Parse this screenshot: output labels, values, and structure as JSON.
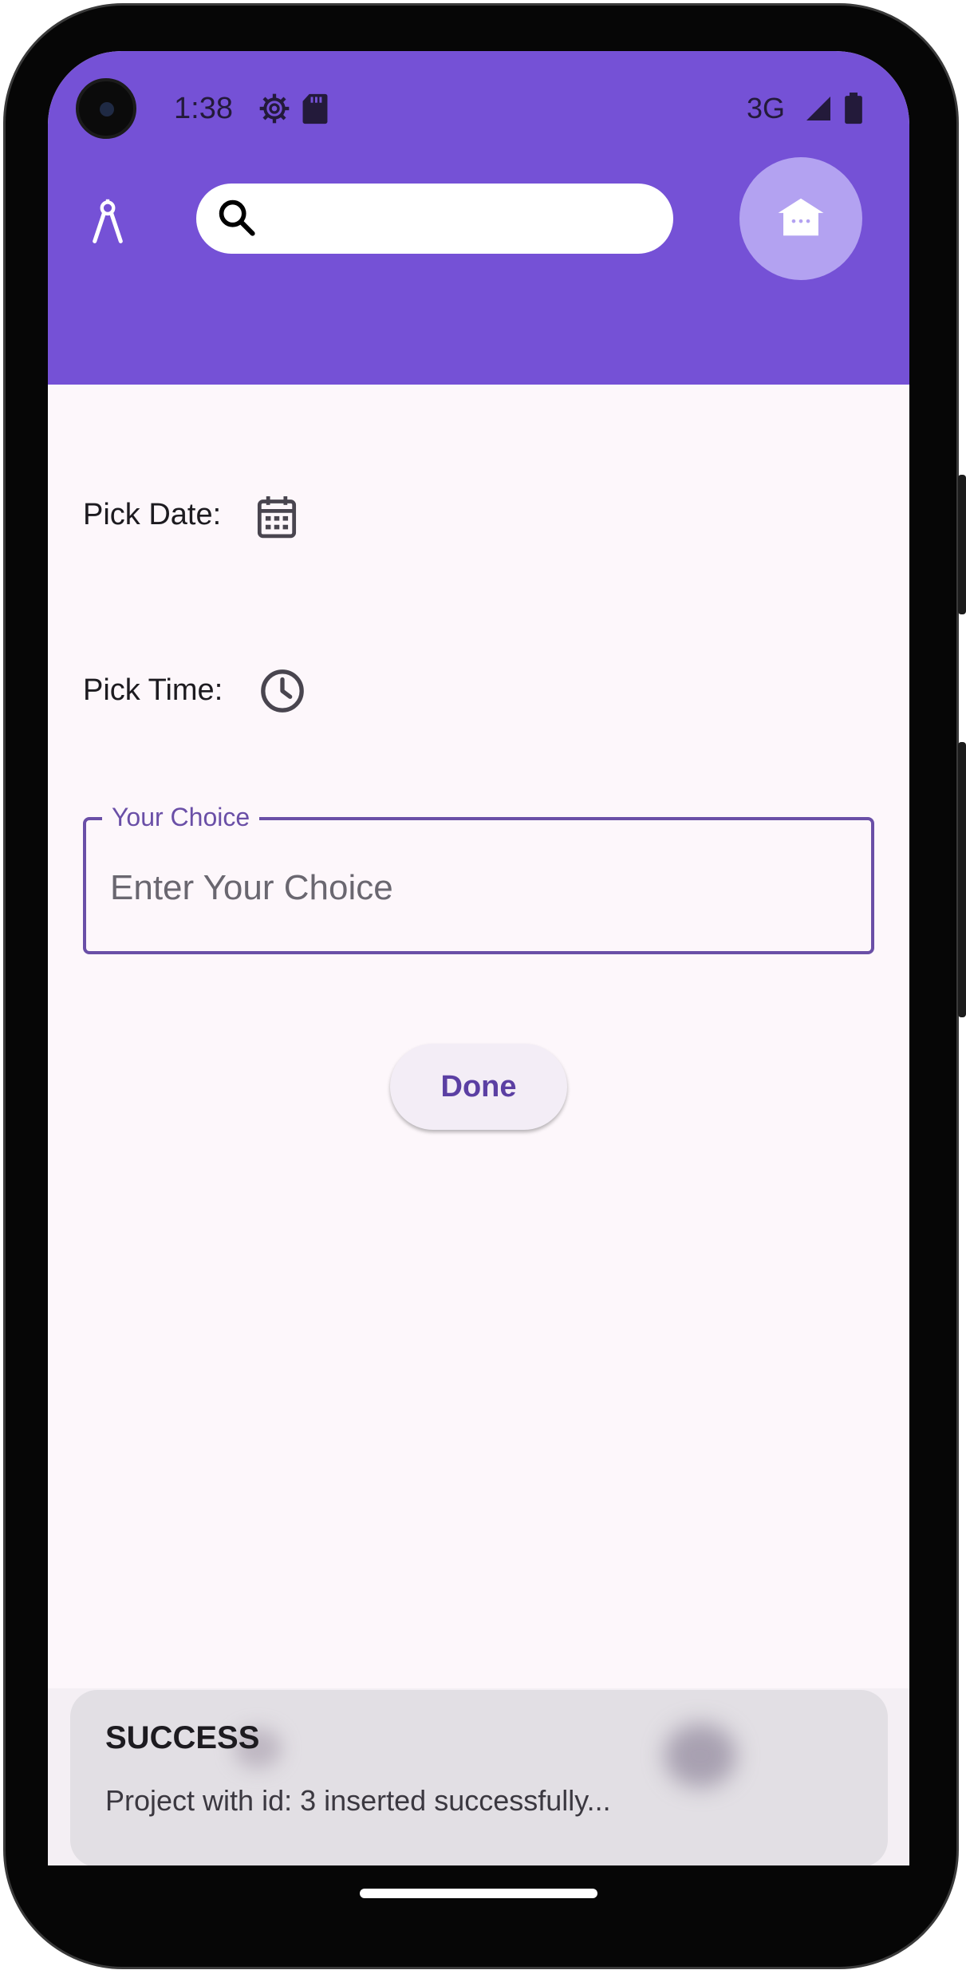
{
  "status_bar": {
    "time": "1:38",
    "network": "3G",
    "icons": [
      "gear-icon",
      "sd-card-icon",
      "signal-icon",
      "battery-icon"
    ]
  },
  "toolbar": {
    "app_icon": "compass-drafting-icon",
    "search_placeholder": "",
    "home_icon": "home-icon"
  },
  "form": {
    "pick_date_label": "Pick Date:",
    "pick_time_label": "Pick Time:",
    "choice_label": "Your Choice",
    "choice_placeholder": "Enter Your Choice",
    "choice_value": "",
    "done_label": "Done"
  },
  "snackbar": {
    "title": "SUCCESS",
    "message": "Project with id: 3 inserted successfully..."
  },
  "colors": {
    "header": "#7551d6",
    "accent": "#6a4fa7",
    "home_button": "#b3a2f1",
    "background": "#fdf7fb"
  }
}
